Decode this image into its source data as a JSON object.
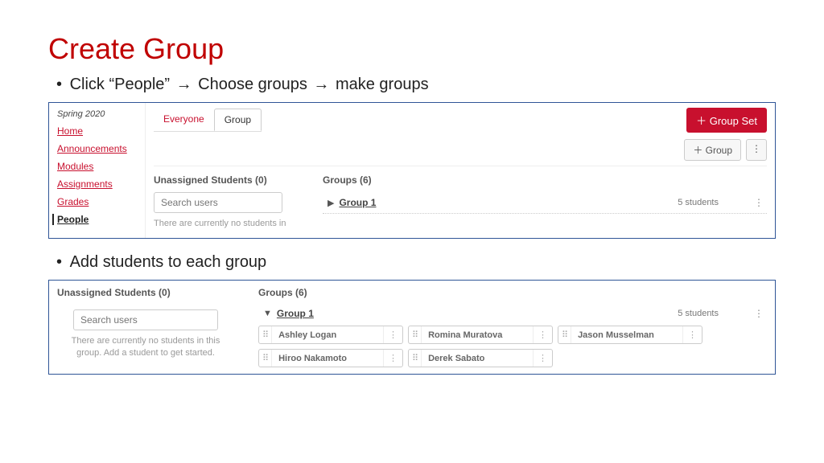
{
  "title": "Create Group",
  "bullet1": {
    "part1": "Click “People” ",
    "arrow": "→",
    "part2": " Choose groups",
    "part3": " make groups"
  },
  "bullet2": "Add students to each group",
  "panel1": {
    "term": "Spring 2020",
    "nav": {
      "home": "Home",
      "announcements": "Announcements",
      "modules": "Modules",
      "assignments": "Assignments",
      "grades": "Grades",
      "people": "People"
    },
    "tabs": {
      "everyone": "Everyone",
      "group": "Group"
    },
    "groupSetBtn": "＋ Group Set",
    "groupBtn": "＋ Group",
    "unassignedHeader": "Unassigned Students (0)",
    "searchPlaceholder": "Search users",
    "emptyMsg": "There are currently no students in",
    "groupsHeader": "Groups (6)",
    "groupName": "Group 1",
    "groupCount": "5 students"
  },
  "panel2": {
    "unassignedHeader": "Unassigned Students (0)",
    "searchPlaceholder": "Search users",
    "emptyMsg": "There are currently no students in this group. Add a student to get started.",
    "groupsHeader": "Groups (6)",
    "groupName": "Group 1",
    "groupCount": "5 students",
    "students": [
      "Ashley Logan",
      "Romina Muratova",
      "Jason Musselman",
      "Hiroo Nakamoto",
      "Derek Sabato"
    ]
  }
}
